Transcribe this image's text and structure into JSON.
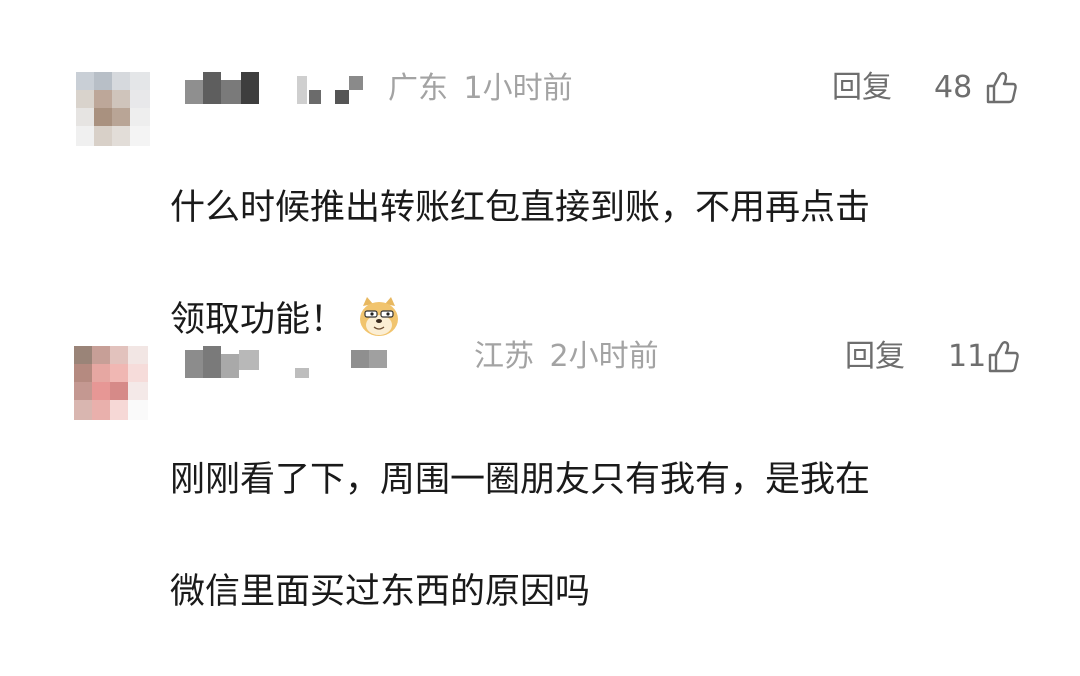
{
  "comments": [
    {
      "location": "广东",
      "time": "1小时前",
      "reply_label": "回复",
      "likes": "48",
      "text_line1": "什么时候推出转账红包直接到账，不用再点击",
      "text_line2": "领取功能！",
      "emoji": "doge-emoji",
      "icon": "thumbs-up-icon"
    },
    {
      "location": "江苏",
      "time": "2小时前",
      "reply_label": "回复",
      "likes": "11",
      "text_line1": "刚刚看了下，周围一圈朋友只有我有，是我在",
      "text_line2": "微信里面买过东西的原因吗",
      "icon": "thumbs-up-icon"
    }
  ]
}
